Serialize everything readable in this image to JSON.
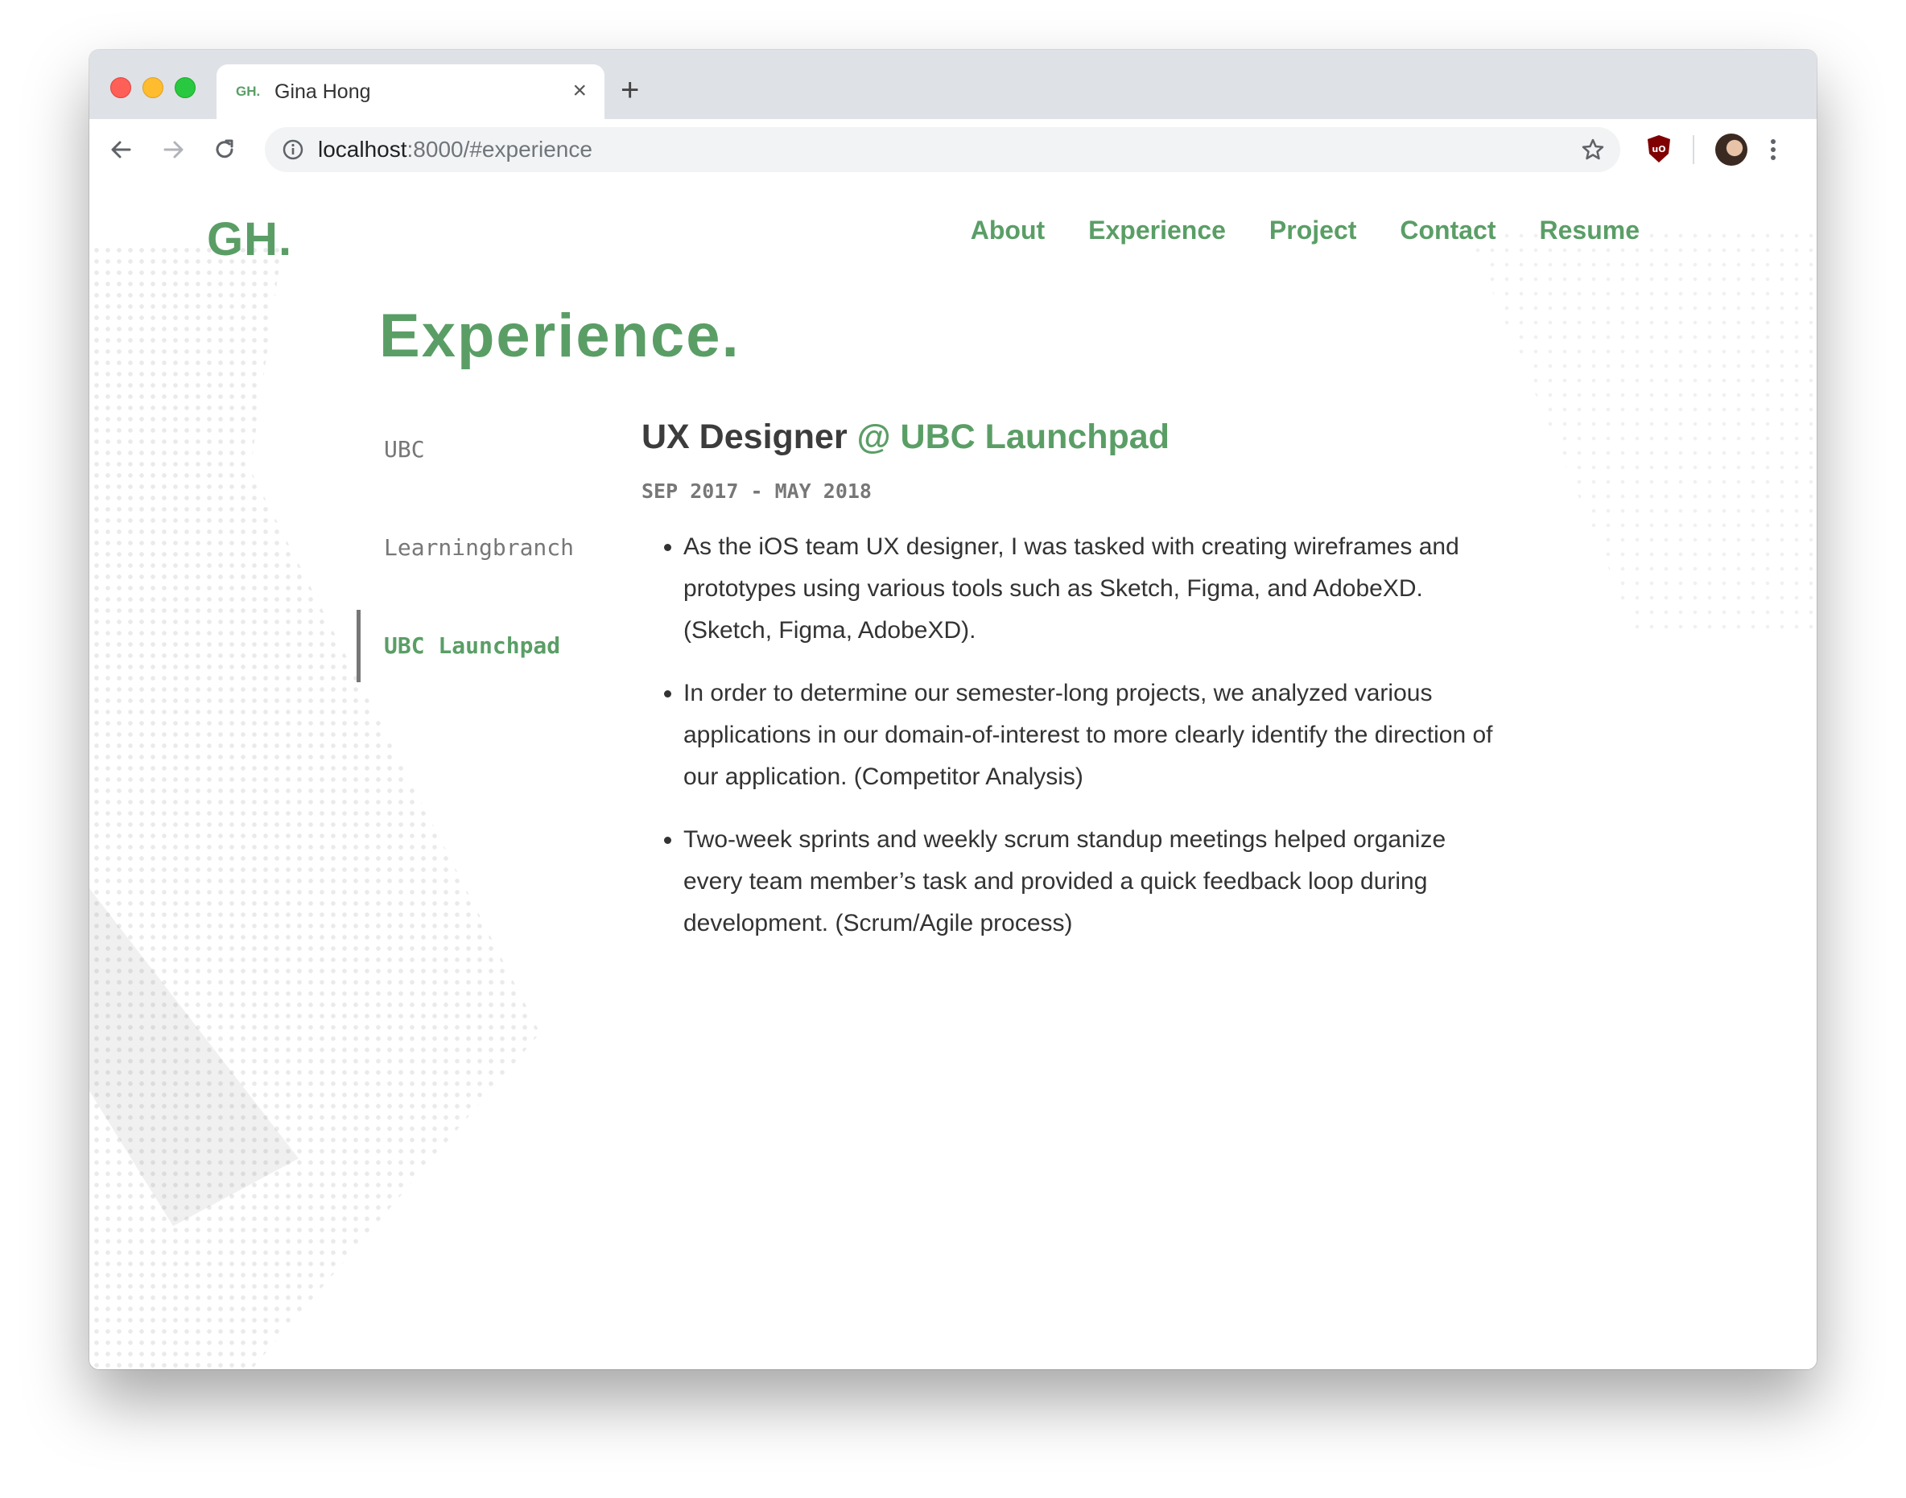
{
  "browser": {
    "tab_favicon": "GH.",
    "tab_title": "Gina Hong",
    "new_tab_icon": "+",
    "close_icon": "×",
    "url_host": "localhost",
    "url_rest": ":8000/#experience"
  },
  "site": {
    "logo": "GH.",
    "nav": {
      "about": "About",
      "experience": "Experience",
      "project": "Project",
      "contact": "Contact",
      "resume": "Resume"
    },
    "accent_color": "#5a9e66"
  },
  "experience": {
    "title": "Experience.",
    "jobs": [
      "UBC",
      "Learningbranch",
      "UBC Launchpad"
    ],
    "active_job": "UBC Launchpad",
    "role": "UX Designer",
    "company": "@ UBC Launchpad",
    "dates": "SEP 2017 - MAY 2018",
    "bullets": [
      "As the iOS team UX designer, I was tasked with creating wireframes and prototypes using various tools such as Sketch, Figma, and AdobeXD. (Sketch, Figma, AdobeXD).",
      "In order to determine our semester-long projects, we analyzed various applications in our domain-of-interest to more clearly identify the direction of our application. (Competitor Analysis)",
      "Two-week sprints and weekly scrum standup meetings helped organize every team member’s task and provided a quick feedback loop during development. (Scrum/Agile process)"
    ]
  }
}
